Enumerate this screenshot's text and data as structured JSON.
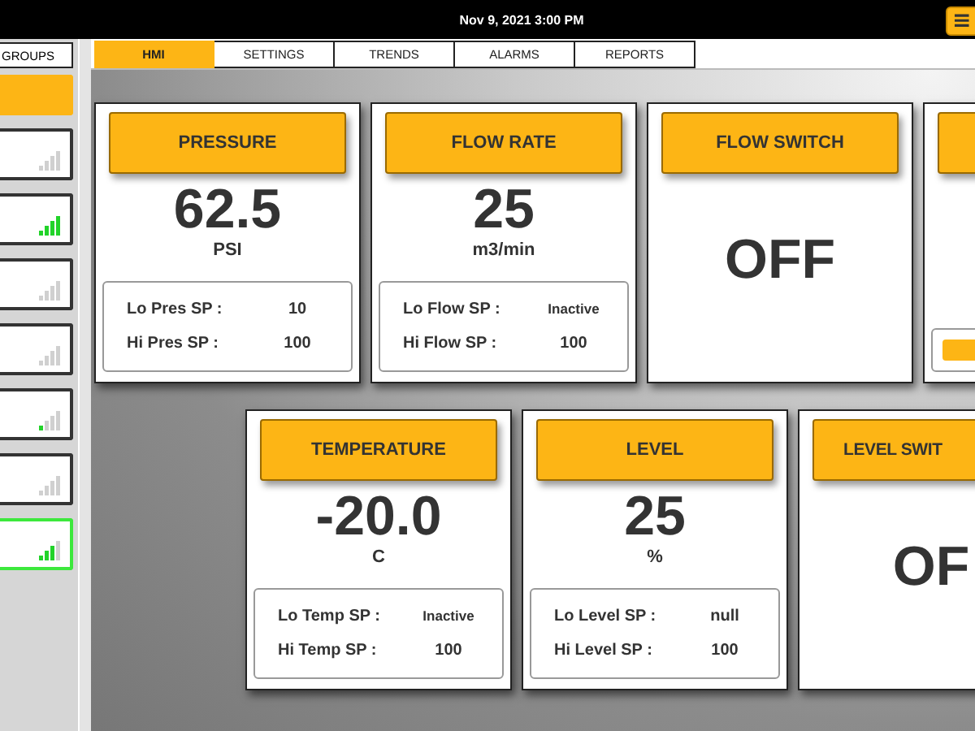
{
  "top_bar": {
    "datetime": "Nov 9, 2021 3:00 PM",
    "menu_button": "≡"
  },
  "sidebar": {
    "title": "GROUPS",
    "items": [
      {
        "selected": true,
        "alert": false,
        "kind": "blank"
      },
      {
        "selected": false,
        "alert": false,
        "kind": "offline"
      },
      {
        "selected": false,
        "alert": false,
        "kind": "strong"
      },
      {
        "selected": false,
        "alert": false,
        "kind": "offline"
      },
      {
        "selected": false,
        "alert": false,
        "kind": "offline"
      },
      {
        "selected": false,
        "alert": false,
        "kind": "weak"
      },
      {
        "selected": false,
        "alert": false,
        "kind": "offline"
      },
      {
        "selected": false,
        "alert": true,
        "kind": "good"
      }
    ]
  },
  "tabs": [
    {
      "label": "HMI",
      "selected": true
    },
    {
      "label": "SETTINGS",
      "selected": false
    },
    {
      "label": "TRENDS",
      "selected": false
    },
    {
      "label": "ALARMS",
      "selected": false
    },
    {
      "label": "REPORTS",
      "selected": false
    }
  ],
  "card_rows": [
    {
      "cards": [
        {
          "kind": "analog",
          "title": "PRESSURE",
          "value": "62.5",
          "unit": "PSI",
          "setpoints": [
            {
              "label": "Lo Pres SP :",
              "value": "10"
            },
            {
              "label": "Hi Pres SP :",
              "value": "100"
            }
          ]
        },
        {
          "kind": "analog",
          "title": "FLOW RATE",
          "value": "25",
          "unit": "m3/min",
          "setpoints": [
            {
              "label": "Lo Flow SP :",
              "value": "Inactive"
            },
            {
              "label": "Hi Flow SP :",
              "value": "100"
            }
          ]
        },
        {
          "kind": "switch",
          "title": "FLOW SWITCH",
          "value": "OFF"
        },
        {
          "kind": "partial"
        }
      ]
    },
    {
      "cards": [
        {
          "kind": "analog",
          "title": "TEMPERATURE",
          "value": "-20.0",
          "unit": "C",
          "setpoints": [
            {
              "label": "Lo Temp SP :",
              "value": "Inactive"
            },
            {
              "label": "Hi Temp SP :",
              "value": "100"
            }
          ]
        },
        {
          "kind": "analog",
          "title": "LEVEL",
          "value": "25",
          "unit": "%",
          "setpoints": [
            {
              "label": "Lo Level SP :",
              "value": "null"
            },
            {
              "label": "Hi Level SP :",
              "value": "100"
            }
          ]
        },
        {
          "kind": "switch",
          "title": "LEVEL SWIT",
          "value": "OF"
        }
      ]
    }
  ]
}
